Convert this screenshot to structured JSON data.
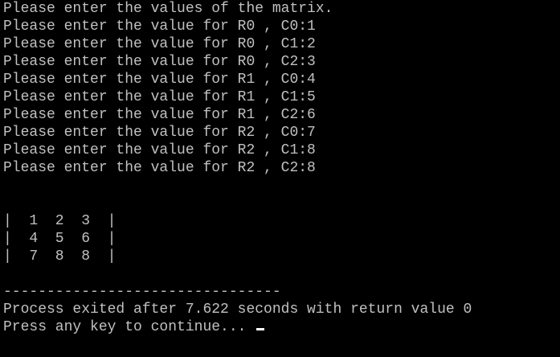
{
  "console": {
    "text_color": "#c0c0c0",
    "background_color": "#000000",
    "prompt_header": "Please enter the values of the matrix.",
    "input_lines": [
      "Please enter the value for R0 , C0:1",
      "Please enter the value for R0 , C1:2",
      "Please enter the value for R0 , C2:3",
      "Please enter the value for R1 , C0:4",
      "Please enter the value for R1 , C1:5",
      "Please enter the value for R1 , C2:6",
      "Please enter the value for R2 , C0:7",
      "Please enter the value for R2 , C1:8",
      "Please enter the value for R2 , C2:8"
    ],
    "matrix_rows": [
      "|  1  2  3  |",
      "|  4  5  6  |",
      "|  7  8  8  |"
    ],
    "separator": "--------------------------------",
    "exit_message": "Process exited after 7.622 seconds with return value 0",
    "continue_prompt": "Press any key to continue... "
  }
}
